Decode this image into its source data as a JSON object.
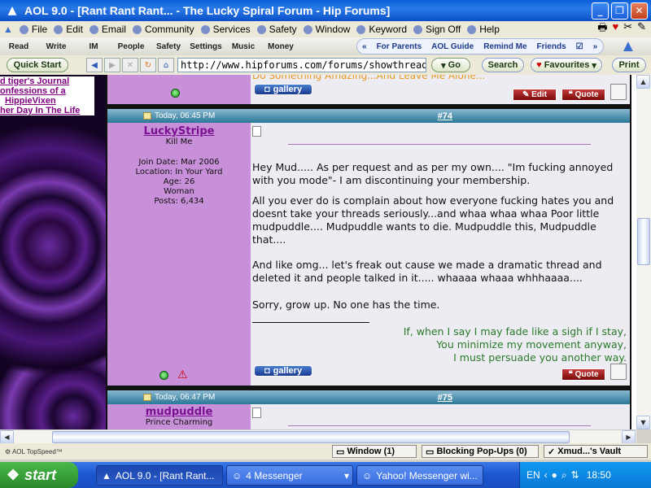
{
  "window": {
    "title": "AOL 9.0 - [Rant Rant Rant... - The Lucky Spiral Forum - Hip Forums]"
  },
  "menu": [
    "File",
    "Edit",
    "Email",
    "Community",
    "Services",
    "Safety",
    "Window",
    "Keyword",
    "Sign Off",
    "Help"
  ],
  "toolbar": [
    "Read",
    "Write",
    "IM",
    "People",
    "Safety",
    "Settings",
    "Music",
    "Money"
  ],
  "toolbar_right": [
    "For Parents",
    "AOL Guide",
    "Remind Me",
    "Friends"
  ],
  "nav": {
    "quick_start": "Quick Start",
    "url": "http://www.hipforums.com/forums/showthread.php?p",
    "go": "Go",
    "search": "Search",
    "favourites": "Favourites",
    "print": "Print"
  },
  "sidebar_links": [
    "d tiger's Journal",
    "onfessions of a",
    "HippieVixen",
    "her Day In The Life"
  ],
  "top_partial": {
    "text": "Do Something Amazing...And Leave Me Alone...",
    "gallery": "gallery",
    "edit": "Edit",
    "quote": "Quote"
  },
  "post74": {
    "date": "Today, 06:45 PM",
    "number": "#74",
    "username": "LuckyStripe",
    "user_title": "Kill Me",
    "join_date": "Join Date: Mar 2006",
    "location": "Location: In Your Yard",
    "age": "Age: 26",
    "gender": "Woman",
    "posts": "Posts: 6,434",
    "para1": "Hey Mud..... As per request and as per my own.... \"Im fucking annoyed with you mode\"- I am discontinuing your membership.",
    "para2": "All you ever do is complain about how everyone fucking hates you and doesnt take your threads seriously...and whaa whaa whaa Poor little mudpuddle.... Mudpuddle wants to die. Mudpuddle this, Mudpuddle that....",
    "para3": "And like omg... let's freak out cause we made a dramatic thread and deleted it and people talked in it..... whaaaa whaaa whhhaaaa....",
    "para4": "Sorry, grow up. No one has the time.",
    "sig1": "If, when I say I may fade like a sigh if I stay,",
    "sig2": "You minimize my movement anyway,",
    "sig3": "I must persuade you another way.",
    "gallery": "gallery",
    "quote": "Quote"
  },
  "post75": {
    "date": "Today, 06:47 PM",
    "number": "#75",
    "username": "mudpuddle",
    "user_title": "Prince Charming"
  },
  "status": {
    "topspeed": "AOL TopSpeed™",
    "window": "Window (1)",
    "popups": "Blocking Pop-Ups (0)",
    "vault": "Xmud...'s Vault"
  },
  "taskbar": {
    "start": "start",
    "task1": "AOL 9.0 - [Rant Rant...",
    "task2": "4 Messenger",
    "task3": "Yahoo! Messenger wi...",
    "lang": "EN",
    "clock": "18:50"
  }
}
